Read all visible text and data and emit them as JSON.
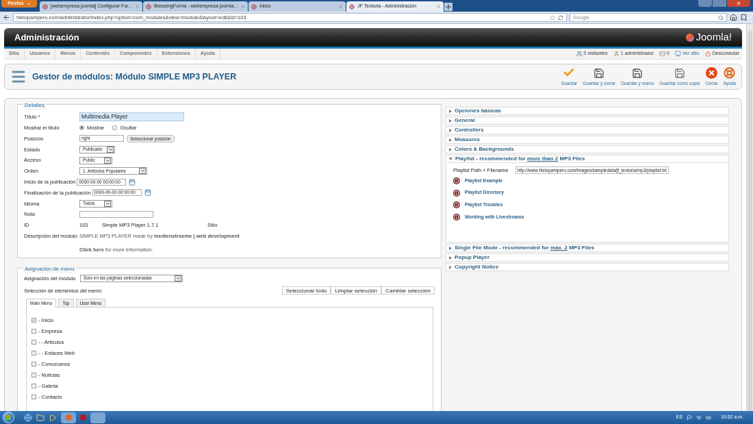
{
  "browser": {
    "menu_button": "Firefox",
    "tabs": [
      {
        "title": "[webempresa joomla] Configurar For...",
        "selected": false
      },
      {
        "title": "BreezingForms - webempresa joomla...",
        "selected": false
      },
      {
        "title": "Inicio",
        "selected": false
      },
      {
        "title": "JF Texturia - Administración",
        "selected": true
      }
    ],
    "address": "hielopampero.com/administrator/index.php?option=com_modules&view=module&layout=edit&id=103",
    "search": {
      "placeholder": "Google"
    }
  },
  "header": {
    "title": "Administración",
    "logo": "Joomla!"
  },
  "menu": [
    "Sitio",
    "Usuarios",
    "Menús",
    "Contenido",
    "Componentes",
    "Extensiones",
    "Ayuda"
  ],
  "status": [
    {
      "kind": "visitors",
      "text": "0 visitantes"
    },
    {
      "kind": "admins",
      "text": "1 administrador"
    },
    {
      "kind": "messages",
      "text": "0"
    },
    {
      "kind": "site",
      "text": "Ver sitio"
    },
    {
      "kind": "logout",
      "text": "Desconectar"
    }
  ],
  "toolbar": {
    "title": "Gestor de módulos: Módulo SIMPLE MP3 PLAYER",
    "buttons": [
      {
        "kind": "save",
        "label": "Guardar"
      },
      {
        "kind": "save-close",
        "label": "Guardar y cerrar"
      },
      {
        "kind": "save-new",
        "label": "Guardar y nuevo"
      },
      {
        "kind": "save-copy",
        "label": "Guardar como copia"
      },
      {
        "kind": "close",
        "label": "Cerrar"
      },
      {
        "kind": "help",
        "label": "Ayuda"
      }
    ]
  },
  "details": {
    "legend": "Detalles",
    "rows": [
      {
        "kind": "title",
        "label": "Título",
        "required": "*",
        "value": "Multimedia Player"
      },
      {
        "kind": "radio",
        "label": "Mostrar el título",
        "options": [
          {
            "label": "Mostrar",
            "selected": true
          },
          {
            "label": "Ocultar",
            "selected": false
          }
        ]
      },
      {
        "kind": "position",
        "label": "Posición",
        "value": "right",
        "button": "Seleccionar posición"
      },
      {
        "kind": "select",
        "label": "Estado",
        "value": "Publicado"
      },
      {
        "kind": "select",
        "label": "Acceso",
        "value": "Public"
      },
      {
        "kind": "select",
        "label": "Orden",
        "value": "1. Articulos Populares"
      },
      {
        "kind": "date",
        "label": "Inicio de la publicación",
        "value": "0000-00-00 00:00:00"
      },
      {
        "kind": "date",
        "label": "Finalización de la publicación",
        "value": "0000-00-00 00:00:00"
      },
      {
        "kind": "select",
        "label": "Idioma",
        "value": "Todos"
      },
      {
        "kind": "note",
        "label": "Nota"
      },
      {
        "kind": "id",
        "label": "ID",
        "values": [
          "103",
          "Simple MP3 Player 1.7.1",
          "Sitio"
        ]
      },
      {
        "kind": "description",
        "label": "Descripción del módulo",
        "text": "SIMPLE MP3 PLAYER made by **medienstroeme | web development**"
      },
      {
        "kind": "info",
        "text": "**Click here** for more Information."
      }
    ]
  },
  "menu_assignment": {
    "legend": "Asignación de menú",
    "assignment_label": "Asignación del módulo",
    "assignment_value": "Solo en las páginas seleccionadas",
    "selection_label": "Selección de elementos del menú:",
    "buttons": [
      "Seleccionar todo",
      "Limpiar selección",
      "Cambiar selección"
    ],
    "tabs": [
      {
        "label": "Main Menu",
        "selected": true
      },
      {
        "label": "Top",
        "selected": false
      },
      {
        "label": "User Menu",
        "selected": false
      }
    ],
    "items": [
      {
        "label": "- Inicio",
        "checked": true
      },
      {
        "label": "- Empresa",
        "checked": false
      },
      {
        "label": "- - Articulos",
        "checked": false
      },
      {
        "label": "- - Enlaces Web",
        "checked": false
      },
      {
        "label": "- Conozcanos",
        "checked": false
      },
      {
        "label": "- Noticias",
        "checked": false
      },
      {
        "label": "- Galeria",
        "checked": false
      },
      {
        "label": "- Contacto",
        "checked": false
      }
    ]
  },
  "panels": [
    {
      "title": "Opciones básicas",
      "expanded": false
    },
    {
      "title": "General",
      "expanded": false
    },
    {
      "title": "Controllers",
      "expanded": false
    },
    {
      "title": "Measures",
      "expanded": false
    },
    {
      "title": "Colors & Backgrounds",
      "expanded": false
    },
    {
      "title": "Playlist - recommended for",
      "link": "more than 2",
      "title_end": "MP3 Files",
      "expanded": true,
      "field_label": "Playlist Path + Filename",
      "field_value": "http://www.hielopampero.com/images/sampledata/jf_texturia/mp3/playlist.txt",
      "links": [
        "Playlist Example",
        "Playlist Directory",
        "Playlist Troubles",
        "Working with Livestreams"
      ]
    },
    {
      "title": "Single File Mode - recommended for",
      "link": "max. 2",
      "title_end": "MP3 Files",
      "expanded": false
    },
    {
      "title": "Popup Player",
      "expanded": false
    },
    {
      "title": "Copyright Notice",
      "expanded": false
    }
  ],
  "taskbar": {
    "language": "ES",
    "time": "10:52 a.m."
  }
}
